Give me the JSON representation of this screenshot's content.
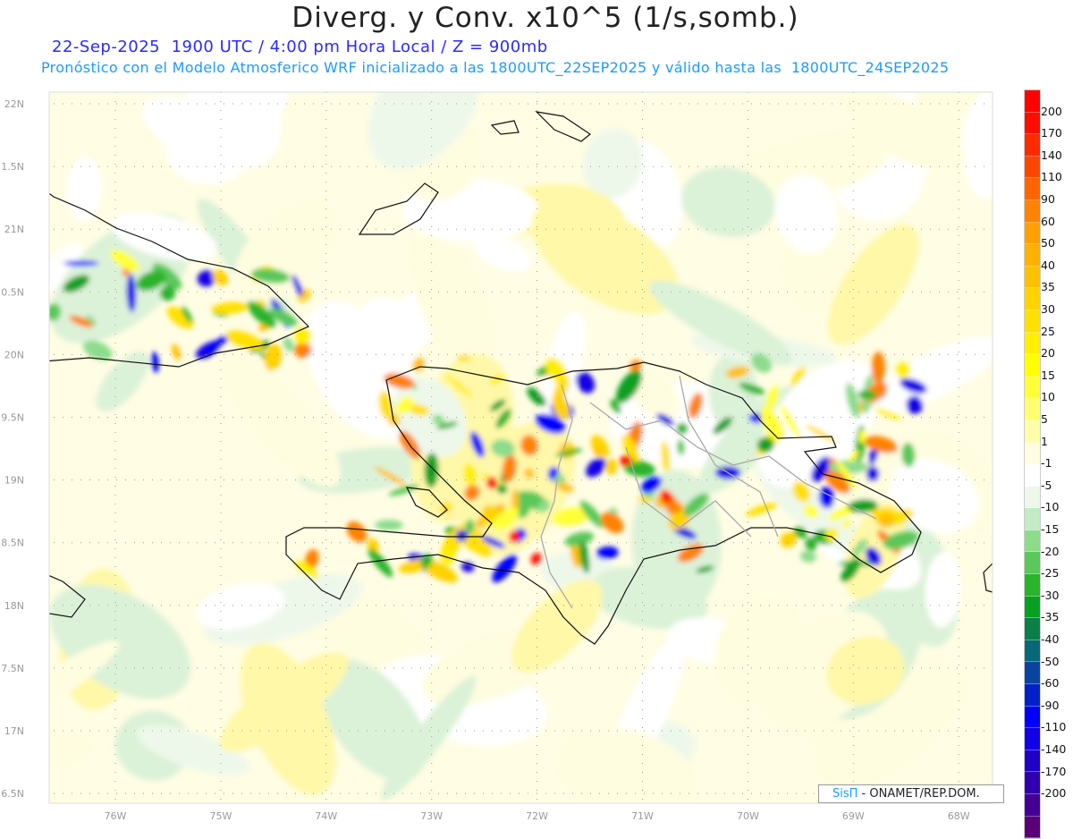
{
  "header": {
    "title": "Diverg. y Conv. x10^5 (1/s,somb.)",
    "subtitle_time": "22-Sep-2025  1900 UTC / 4:00 pm Hora Local / Z = 900mb",
    "subtitle_model": "Pronóstico con el Modelo Atmosferico WRF inicializado a las 1800UTC_22SEP2025 y válido hasta las  1800UTC_24SEP2025"
  },
  "map": {
    "lat_labels": [
      "22N",
      "1.5N",
      "21N",
      "0.5N",
      "20N",
      "9.5N",
      "19N",
      "8.5N",
      "18N",
      "7.5N",
      "17N",
      "6.5N"
    ],
    "lon_labels": [
      "76W",
      "75W",
      "74W",
      "73W",
      "72W",
      "71W",
      "70W",
      "69W",
      "68W"
    ]
  },
  "colorbar": {
    "labels": [
      "200",
      "170",
      "140",
      "110",
      "90",
      "60",
      "50",
      "40",
      "35",
      "30",
      "25",
      "20",
      "15",
      "10",
      "5",
      "1",
      "-1",
      "-5",
      "-10",
      "-15",
      "-20",
      "-25",
      "-30",
      "-35",
      "-40",
      "-50",
      "-60",
      "-90",
      "-110",
      "-140",
      "-170",
      "-200"
    ],
    "colors": [
      "#ff0000",
      "#ff0c00",
      "#ff2a00",
      "#ff4600",
      "#ff6400",
      "#ff8200",
      "#ffa000",
      "#ffb000",
      "#ffc000",
      "#ffd200",
      "#ffe000",
      "#ffee00",
      "#ffff00",
      "#ffff38",
      "#ffff70",
      "#ffffa8",
      "#fffde0",
      "#ffffff",
      "#eef8ea",
      "#c2ecc2",
      "#8cdc8c",
      "#5ac85a",
      "#2ab42a",
      "#08a020",
      "#0a8048",
      "#066878",
      "#0a44a0",
      "#0022c8",
      "#0000ff",
      "#1200e6",
      "#2000c8",
      "#3000b0",
      "#440096",
      "#5a0078"
    ]
  },
  "credit": {
    "brand": "SisΠ",
    "text": " - ONAMET/REP.DOM."
  }
}
